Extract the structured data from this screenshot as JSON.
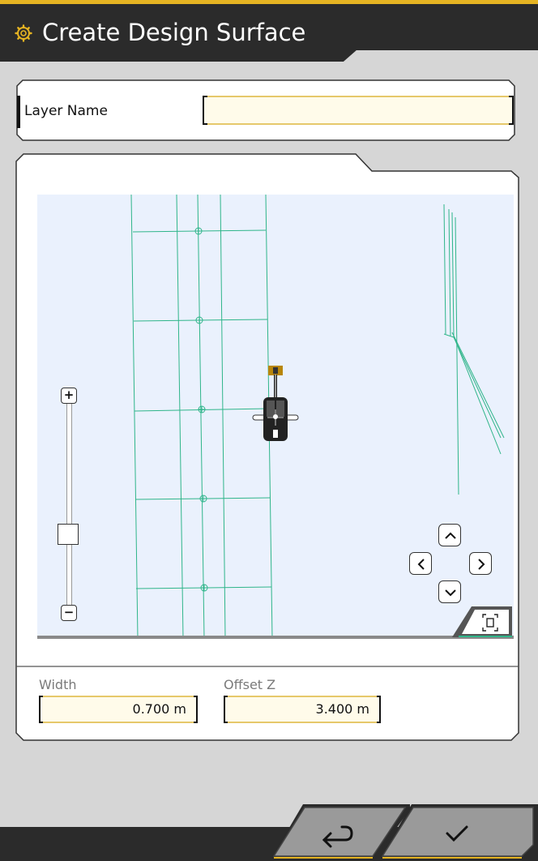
{
  "header": {
    "title": "Create Design Surface",
    "icon": "gear-icon",
    "accent_color": "#e6b422",
    "background_color": "#2b2b2b"
  },
  "layer": {
    "label": "Layer Name",
    "value": ""
  },
  "map": {
    "zoom_in_label": "+",
    "zoom_out_label": "−",
    "background_color": "#eaf1fd",
    "line_color": "#2fb58a"
  },
  "fields": {
    "width_label": "Width",
    "width_value": "0.700 m",
    "offset_label": "Offset Z",
    "offset_value": "3.400 m"
  },
  "footer": {
    "back_icon": "return-icon",
    "confirm_icon": "checkmark-icon"
  }
}
